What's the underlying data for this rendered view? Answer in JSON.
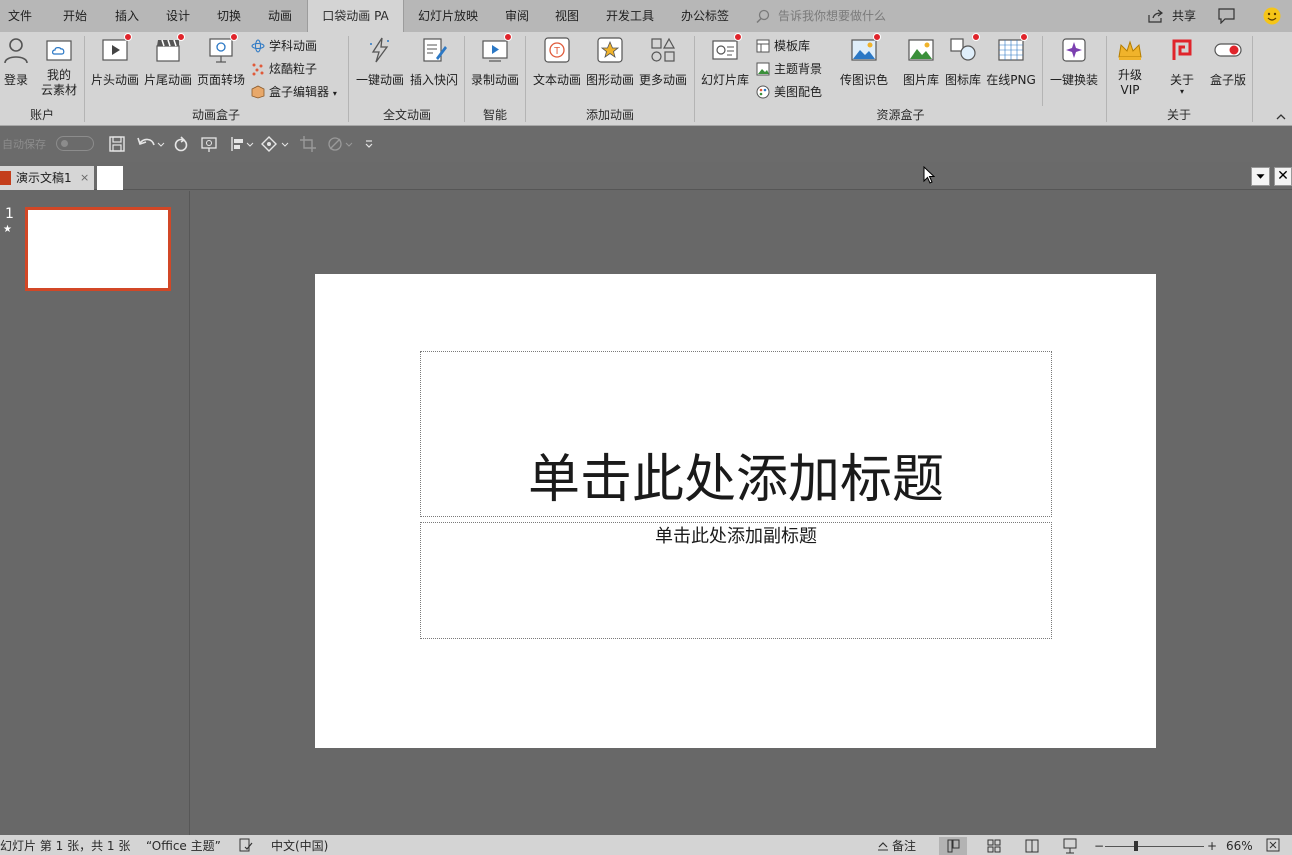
{
  "tabs": [
    {
      "label": "文件",
      "active": false
    },
    {
      "label": "开始",
      "active": false
    },
    {
      "label": "插入",
      "active": false
    },
    {
      "label": "设计",
      "active": false
    },
    {
      "label": "切换",
      "active": false
    },
    {
      "label": "动画",
      "active": false
    },
    {
      "label": "口袋动画 PA",
      "active": true
    },
    {
      "label": "幻灯片放映",
      "active": false
    },
    {
      "label": "审阅",
      "active": false
    },
    {
      "label": "视图",
      "active": false
    },
    {
      "label": "开发工具",
      "active": false
    },
    {
      "label": "办公标签",
      "active": false
    }
  ],
  "tell_me": {
    "placeholder": "告诉我你想要做什么"
  },
  "share": {
    "label": "共享"
  },
  "ribbon": {
    "groups": [
      "账户",
      "动画盒子",
      "全文动画",
      "智能",
      "添加动画",
      "资源盒子",
      "关于"
    ],
    "buttons": {
      "login": "登录",
      "cloud_line1": "我的",
      "cloud_line2": "云素材",
      "head_anim": "片头动画",
      "tail_anim": "片尾动画",
      "page_transition": "页面转场",
      "subject_anim": "学科动画",
      "cool_particles": "炫酷粒子",
      "box_editor": "盒子编辑器",
      "one_key_anim": "一键动画",
      "insert_flash": "插入快闪",
      "record_anim": "录制动画",
      "text_anim": "文本动画",
      "shape_anim": "图形动画",
      "more_anim": "更多动画",
      "slide_library": "幻灯片库",
      "template_library": "模板库",
      "theme_background": "主题背景",
      "color_scheme": "美图配色",
      "pass_color": "传图识色",
      "image_library": "图片库",
      "icon_library": "图标库",
      "online_png": "在线PNG",
      "one_key_replace": "一键换装",
      "upgrade_line1": "升级",
      "upgrade_line2": "VIP",
      "about": "关于",
      "box_version": "盒子版"
    }
  },
  "qat": {
    "autosave_label": "自动保存"
  },
  "document": {
    "tab_title": "演示文稿1",
    "tab_close": "×",
    "close_glyph": "✕"
  },
  "thumbnails": {
    "slide_number": "1",
    "star": "★"
  },
  "slide": {
    "title_placeholder": "单击此处添加标题",
    "subtitle_placeholder": "单击此处添加副标题"
  },
  "status": {
    "slide_info": "幻灯片 第 1 张，共 1 张",
    "theme": "“Office 主题”",
    "language": "中文(中国)",
    "notes": "备注",
    "zoom_minus": "−",
    "zoom_plus": "+",
    "zoom": "66%"
  },
  "colors": {
    "accent": "#d24726",
    "ribbon_bg": "#d4d4d4",
    "workspace_bg": "#686868",
    "red_badge": "#e0242b"
  }
}
